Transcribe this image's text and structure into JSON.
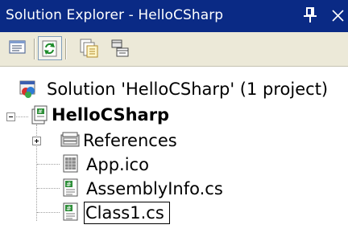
{
  "window": {
    "title": "Solution Explorer - HelloCSharp"
  },
  "titlebar_controls": {
    "pin_glyph": "pin-icon",
    "close_glyph": "close-icon"
  },
  "toolbar": {
    "buttons": [
      {
        "name": "properties-button",
        "icon": "properties-icon",
        "pressed": false
      },
      {
        "name": "refresh-button",
        "icon": "refresh-icon",
        "pressed": true
      },
      {
        "name": "show-all-files-button",
        "icon": "show-all-files-icon",
        "pressed": false
      },
      {
        "name": "view-class-diagram-button",
        "icon": "view-class-diagram-icon",
        "pressed": false
      }
    ]
  },
  "tree": {
    "solution": {
      "label": "Solution 'HelloCSharp' (1 project)",
      "icon": "solution-icon"
    },
    "project": {
      "label": "HelloCSharp",
      "icon": "csharp-project-icon",
      "expanded": true
    },
    "items": [
      {
        "label": "References",
        "icon": "references-icon",
        "collapsed": true
      },
      {
        "label": "App.ico",
        "icon": "ico-file-icon"
      },
      {
        "label": "AssemblyInfo.cs",
        "icon": "cs-file-icon"
      },
      {
        "label": "Class1.cs",
        "icon": "cs-file-icon",
        "selected": true
      }
    ]
  },
  "colors": {
    "titlebar": "#0a2a85",
    "toolbar": "#ece9d8",
    "tree_background": "#ffffff",
    "tree_lines": "#a0a0a0"
  }
}
